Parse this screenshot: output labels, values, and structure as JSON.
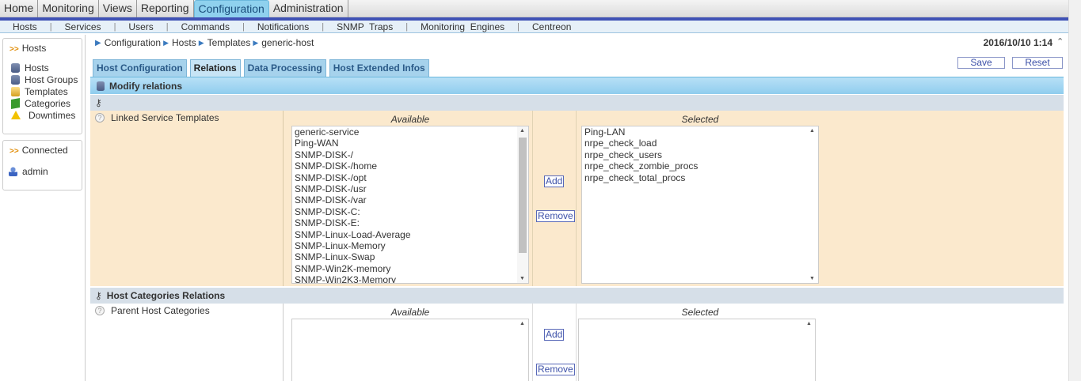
{
  "top_menu": {
    "items": [
      "Home",
      "Monitoring",
      "Views",
      "Reporting",
      "Configuration",
      "Administration"
    ],
    "active": "Configuration"
  },
  "sub_menu": {
    "items": [
      "Hosts",
      "Services",
      "Users",
      "Commands",
      "Notifications",
      "SNMP  Traps",
      "Monitoring  Engines",
      "Centreon"
    ],
    "separator": "|"
  },
  "left_panel": {
    "hosts_heading": "Hosts",
    "hosts_items": [
      "Hosts",
      "Host Groups",
      "Templates",
      "Categories",
      "Downtimes"
    ],
    "connected_heading": "Connected",
    "user": "admin"
  },
  "breadcrumb": [
    "Configuration",
    "Hosts",
    "Templates",
    "generic-host"
  ],
  "datetime": "2016/10/10 1:14",
  "tabs": [
    "Host Configuration",
    "Relations",
    "Data Processing",
    "Host Extended Infos"
  ],
  "active_tab": "Relations",
  "buttons": {
    "save": "Save",
    "reset": "Reset"
  },
  "section": {
    "title": "Modify relations",
    "linked_templates": {
      "label": "Linked Service Templates",
      "available_header": "Available",
      "selected_header": "Selected",
      "available": [
        "generic-service",
        "Ping-WAN",
        "SNMP-DISK-/",
        "SNMP-DISK-/home",
        "SNMP-DISK-/opt",
        "SNMP-DISK-/usr",
        "SNMP-DISK-/var",
        "SNMP-DISK-C:",
        "SNMP-DISK-E:",
        "SNMP-Linux-Load-Average",
        "SNMP-Linux-Memory",
        "SNMP-Linux-Swap",
        "SNMP-Win2K-memory",
        "SNMP-Win2K3-Memory"
      ],
      "selected": [
        "Ping-LAN",
        "nrpe_check_load",
        "nrpe_check_users",
        "nrpe_check_zombie_procs",
        "nrpe_check_total_procs"
      ],
      "add": "Add",
      "remove": "Remove"
    },
    "host_categories": {
      "title": "Host Categories Relations",
      "label": "Parent Host Categories",
      "available_header": "Available",
      "selected_header": "Selected",
      "add": "Add",
      "remove": "Remove"
    }
  },
  "colors": {
    "accent": "#3f51b5",
    "tab_bg": "#a6d2ec",
    "section_bg": "#8fcdee",
    "row_highlight": "#fbe9cd",
    "row_gray": "#d6dfe8"
  }
}
